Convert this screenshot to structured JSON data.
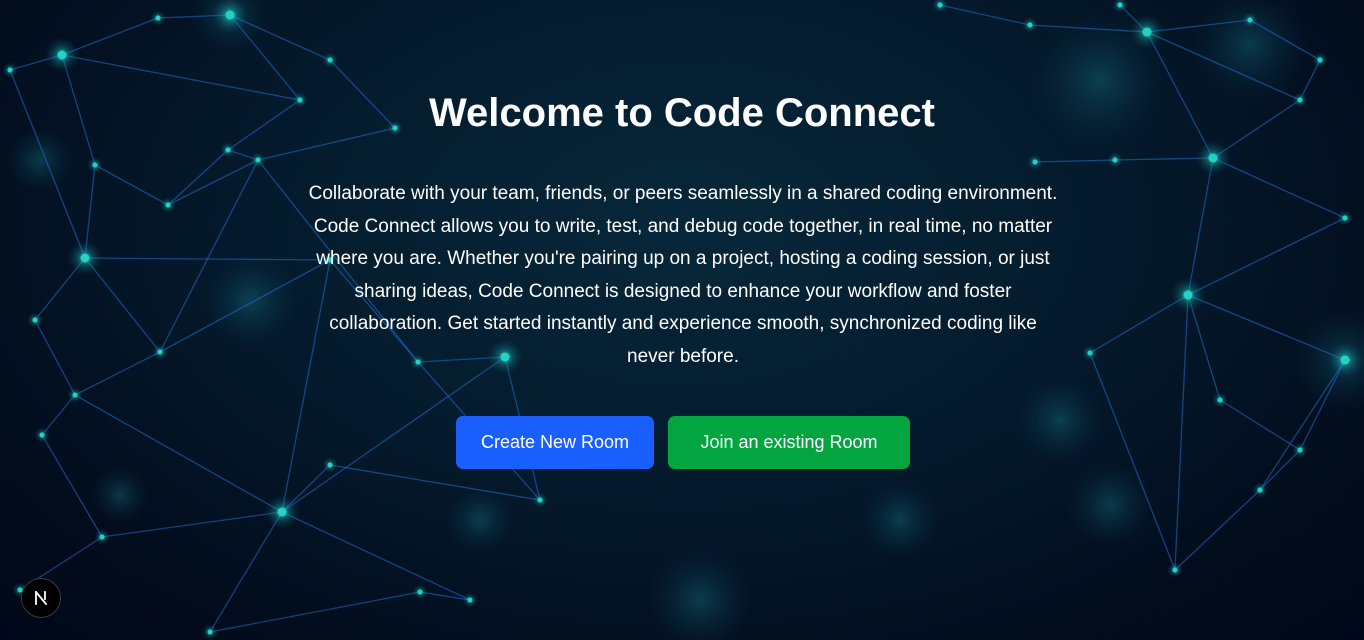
{
  "hero": {
    "title": "Welcome to Code Connect",
    "description": "Collaborate with your team, friends, or peers seamlessly in a shared coding environment. Code Connect allows you to write, test, and debug code together, in real time, no matter where you are. Whether you're pairing up on a project, hosting a coding session, or just sharing ideas, Code Connect is designed to enhance your workflow and foster collaboration. Get started instantly and experience smooth, synchronized coding like never before."
  },
  "actions": {
    "create_label": "Create New Room",
    "join_label": "Join an existing Room"
  },
  "colors": {
    "create_button": "#1a5fff",
    "join_button": "#03a541",
    "network_line": "#1f6fd1",
    "network_node": "#22d3c5"
  },
  "devtools": {
    "icon": "nextjs-logo-icon"
  }
}
